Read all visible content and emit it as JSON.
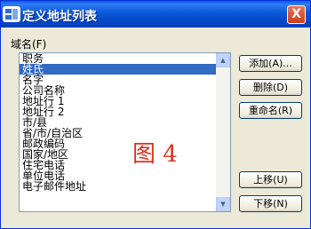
{
  "window": {
    "title": "定义地址列表",
    "close_label": "X"
  },
  "field_label": "域名(F)",
  "list": {
    "items": [
      "职务",
      "姓氏",
      "名字",
      "公司名称",
      "地址行 1",
      "地址行 2",
      "市/县",
      "省/市/自治区",
      "邮政编码",
      "国家/地区",
      "住宅电话",
      "单位电话",
      "电子邮件地址"
    ],
    "selected_index": 1
  },
  "buttons": {
    "add": "添加(A)...",
    "delete": "删除(D)",
    "rename": "重命名(R)",
    "move_up": "上移(U)",
    "move_down": "下移(N)"
  },
  "annotation": "图 4",
  "colors": {
    "titlebar": "#0a58d8",
    "selection": "#316ac5",
    "annotation": "#e0301e"
  }
}
